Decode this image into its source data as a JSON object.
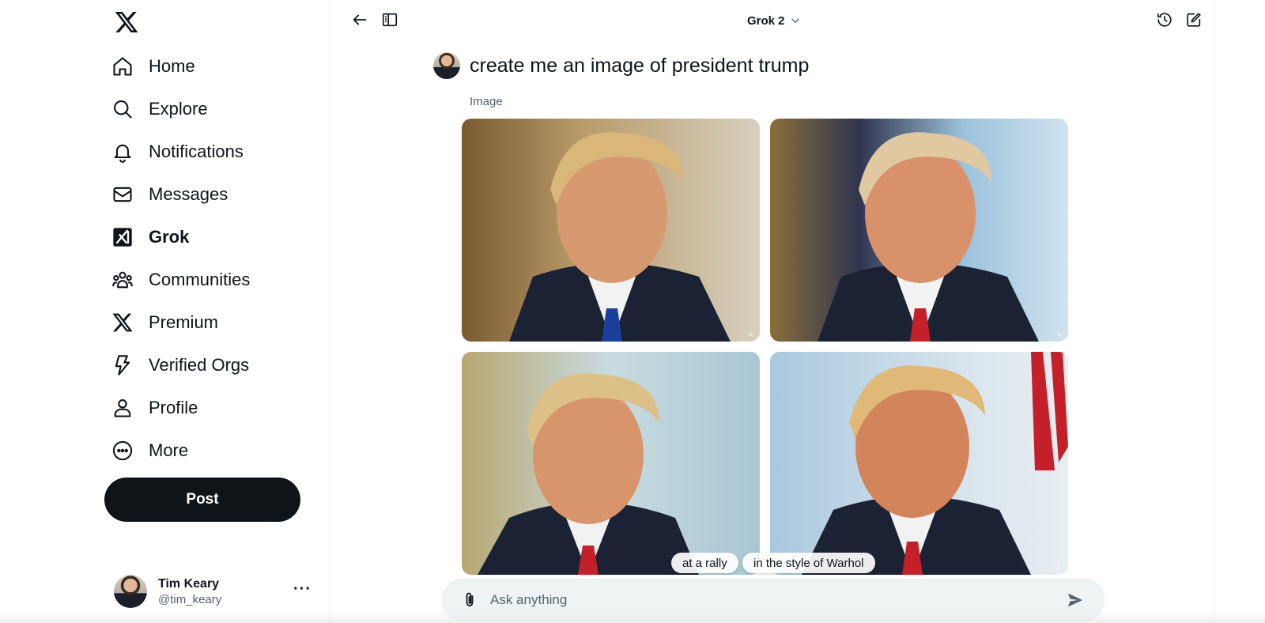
{
  "app": {
    "logo": "x-logo-icon"
  },
  "sidebar": {
    "items": [
      {
        "label": "Home",
        "icon": "home-icon",
        "active": false
      },
      {
        "label": "Explore",
        "icon": "search-icon",
        "active": false
      },
      {
        "label": "Notifications",
        "icon": "bell-icon",
        "active": false
      },
      {
        "label": "Messages",
        "icon": "envelope-icon",
        "active": false
      },
      {
        "label": "Grok",
        "icon": "grok-icon",
        "active": true
      },
      {
        "label": "Communities",
        "icon": "communities-icon",
        "active": false
      },
      {
        "label": "Premium",
        "icon": "x-premium-icon",
        "active": false
      },
      {
        "label": "Verified Orgs",
        "icon": "lightning-icon",
        "active": false
      },
      {
        "label": "Profile",
        "icon": "person-icon",
        "active": false
      },
      {
        "label": "More",
        "icon": "more-circle-icon",
        "active": false
      }
    ],
    "post_label": "Post",
    "account": {
      "name": "Tim Keary",
      "handle": "@tim_keary",
      "more": "···"
    }
  },
  "header": {
    "model": "Grok 2",
    "icons": [
      "back-arrow-icon",
      "sidebar-toggle-icon",
      "history-icon",
      "new-chat-icon"
    ]
  },
  "chat": {
    "prompt": "create me an image of president trump",
    "result_type": "Image",
    "images": [
      {
        "alt": "generated portrait 1",
        "tie": "#1d3f9c"
      },
      {
        "alt": "generated portrait 2",
        "tie": "#c4202a"
      },
      {
        "alt": "generated portrait 3",
        "tie": "#c4202a"
      },
      {
        "alt": "generated portrait 4",
        "tie": "#c4202a"
      }
    ],
    "suggestions": [
      "at a rally",
      "in the style of Warhol"
    ]
  },
  "composer": {
    "placeholder": "Ask anything",
    "value": ""
  },
  "colors": {
    "text": "#0f1419",
    "secondary": "#536471",
    "post_button": "#0f1419",
    "composer_bg": "#eff3f4"
  }
}
